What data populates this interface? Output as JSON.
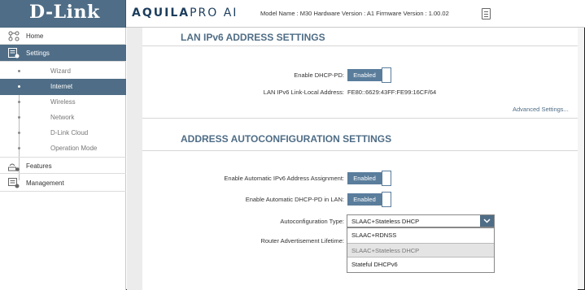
{
  "header": {
    "brand": "D-Link",
    "product_bold": "AQUILA",
    "product_light": "PRO AI",
    "model_info": "Model Name : M30 Hardware Version : A1 Firmware Version : 1.00.02",
    "doc_icon": "document-icon"
  },
  "sidebar": {
    "home": "Home",
    "settings": "Settings",
    "sub_items": [
      "Wizard",
      "Internet",
      "Wireless",
      "Network",
      "D-Link Cloud",
      "Operation Mode"
    ],
    "active_sub": "Internet",
    "features": "Features",
    "management": "Management"
  },
  "lan_section": {
    "title": "LAN IPv6 ADDRESS SETTINGS",
    "dhcp_pd_label": "Enable DHCP-PD:",
    "dhcp_pd_value": "Enabled",
    "link_local_label": "LAN IPv6 Link-Local Address:",
    "link_local_value": "FE80::6629:43FF:FE99:16CF/64",
    "advanced_link": "Advanced Settings..."
  },
  "auto_section": {
    "title": "ADDRESS AUTOCONFIGURATION SETTINGS",
    "auto_assign_label": "Enable Automatic IPv6 Address Assignment:",
    "auto_assign_value": "Enabled",
    "auto_pd_label": "Enable Automatic DHCP-PD in LAN:",
    "auto_pd_value": "Enabled",
    "autoconf_type_label": "Autoconfiguration Type:",
    "autoconf_type_value": "SLAAC+Stateless DHCP",
    "router_adv_label": "Router Advertisement Lifetime:",
    "options": [
      "SLAAC+RDNSS",
      "SLAAC+Stateless DHCP",
      "Stateful DHCPv6"
    ],
    "highlighted_option": "SLAAC+Stateless DHCP"
  },
  "colors": {
    "accent": "#4f6d86",
    "toggle_on": "#5a7d9c"
  }
}
